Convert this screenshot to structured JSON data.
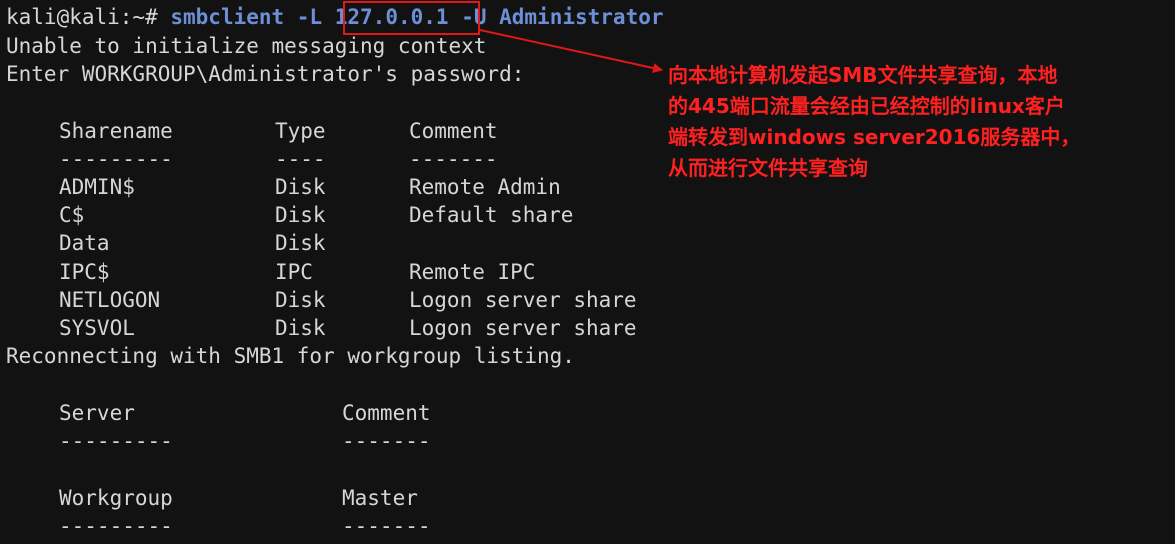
{
  "prompt": "kali@kali:~#",
  "command": {
    "prefix": "smbclient -L",
    "ip": "127.0.0.1",
    "suffix": "-U Administrator"
  },
  "output": {
    "line1": "Unable to initialize messaging context",
    "line2": "Enter WORKGROUP\\Administrator's password:",
    "shares_header": [
      "Sharename",
      "Type",
      "Comment"
    ],
    "shares_sep": [
      "---------",
      "----",
      "-------"
    ],
    "shares": [
      [
        "ADMIN$",
        "Disk",
        "Remote Admin"
      ],
      [
        "C$",
        "Disk",
        "Default share"
      ],
      [
        "Data",
        "Disk",
        ""
      ],
      [
        "IPC$",
        "IPC",
        "Remote IPC"
      ],
      [
        "NETLOGON",
        "Disk",
        "Logon server share"
      ],
      [
        "SYSVOL",
        "Disk",
        "Logon server share"
      ]
    ],
    "reconnect": "Reconnecting with SMB1 for workgroup listing.",
    "server_header": [
      "Server",
      "Comment"
    ],
    "server_sep": [
      "---------",
      "-------"
    ],
    "workgroup_header": [
      "Workgroup",
      "Master"
    ],
    "workgroup_sep": [
      "---------",
      "-------"
    ]
  },
  "annotation": {
    "lines": [
      "向本地计算机发起SMB文件共享查询，本地",
      "的445端口流量会经由已经控制的linux客户",
      "端转发到windows server2016服务器中，",
      "从而进行文件共享查询"
    ]
  },
  "colors": {
    "background": "#121212",
    "text": "#d6d6d6",
    "command": "#6d8fd6",
    "annotation": "#ff2020"
  }
}
